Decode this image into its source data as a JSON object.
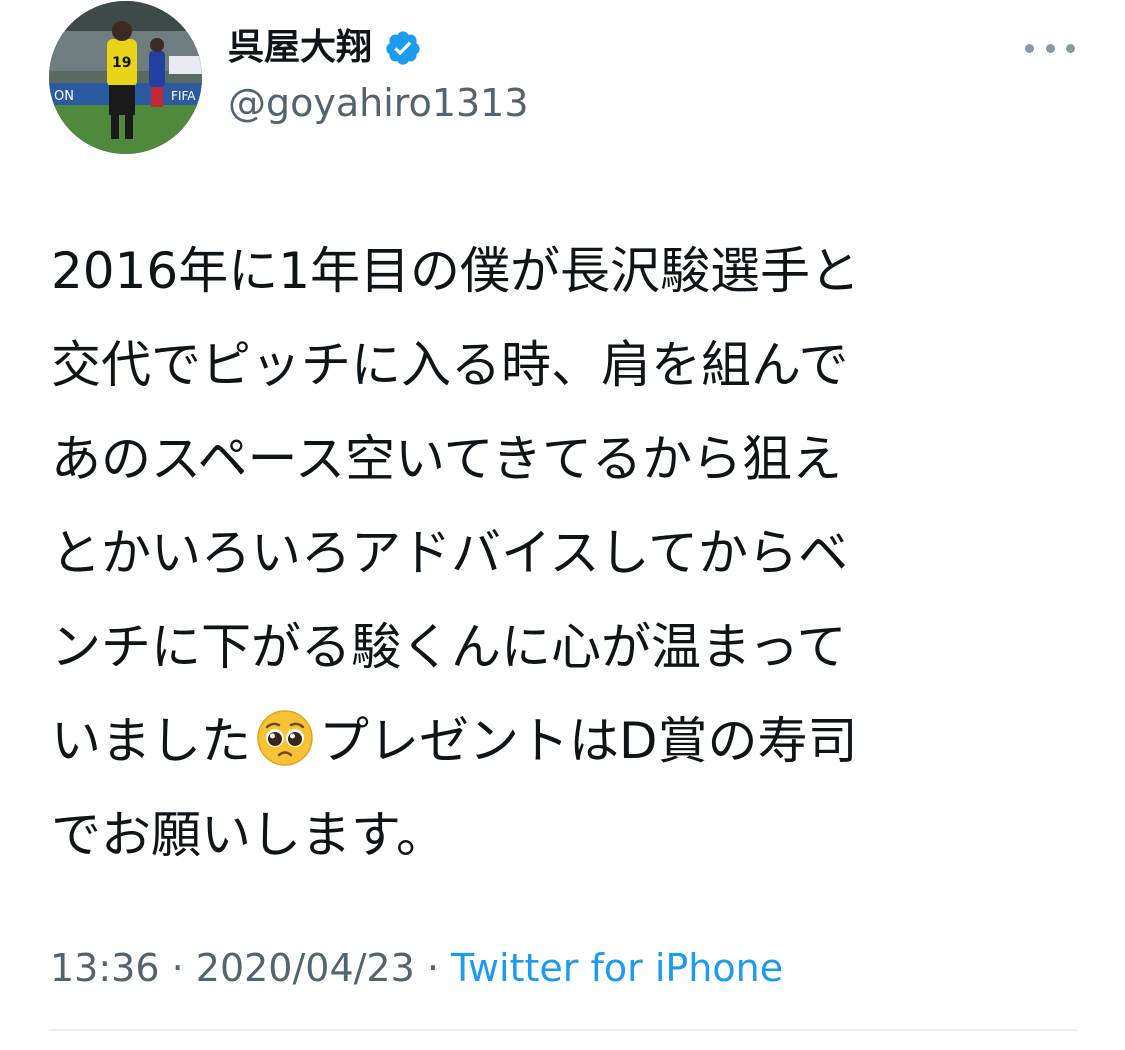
{
  "user": {
    "display_name": "呉屋大翔",
    "handle": "@goyahiro1313",
    "verified": true,
    "avatar": "avatar-photo-soccer-player"
  },
  "tweet": {
    "lines": [
      "2016年に1年目の僕が長沢駿選手と",
      "交代でピッチに入る時、肩を組んで",
      "あのスペース空いてきてるから狙え",
      "とかいろいろアドバイスしてからベ",
      "ンチに下がる駿くんに心が温まって"
    ],
    "line6_before_emoji": "いました",
    "emoji": "pleading-face-emoji",
    "line6_after_emoji": "プレゼントはD賞の寿司",
    "line7": "でお願いします。"
  },
  "meta": {
    "time": "13:36",
    "separator": " · ",
    "date": "2020/04/23",
    "source": "Twitter for iPhone"
  },
  "colors": {
    "accent": "#1d9bf0",
    "secondary_text": "#536471",
    "primary_text": "#0f1419",
    "divider": "#e6ecf0"
  },
  "icons": {
    "verified": "verified-badge-icon",
    "more": "more-options-icon"
  }
}
